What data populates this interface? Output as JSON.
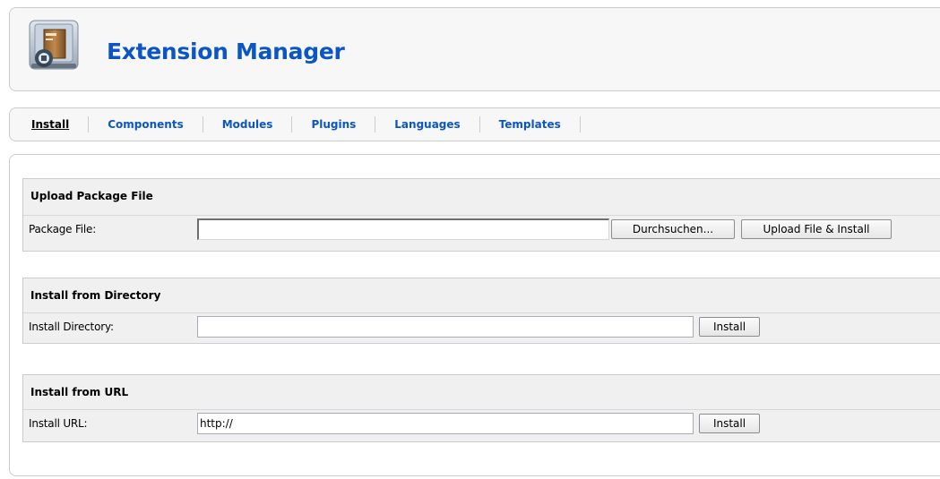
{
  "header": {
    "title": "Extension Manager",
    "icon": "extension-box-icon"
  },
  "tabs": [
    {
      "label": "Install",
      "active": true
    },
    {
      "label": "Components",
      "active": false
    },
    {
      "label": "Modules",
      "active": false
    },
    {
      "label": "Plugins",
      "active": false
    },
    {
      "label": "Languages",
      "active": false
    },
    {
      "label": "Templates",
      "active": false
    }
  ],
  "upload": {
    "title": "Upload Package File",
    "label": "Package File:",
    "value": "",
    "browse_label": "Durchsuchen...",
    "submit_label": "Upload File & Install"
  },
  "directory": {
    "title": "Install from Directory",
    "label": "Install Directory:",
    "value": "",
    "submit_label": "Install"
  },
  "url": {
    "title": "Install from URL",
    "label": "Install URL:",
    "value": "http://",
    "submit_label": "Install"
  },
  "colors": {
    "link": "#0B55C4",
    "panel": "#f7f7f7",
    "section": "#f0f0f0",
    "border": "#cccccc"
  }
}
